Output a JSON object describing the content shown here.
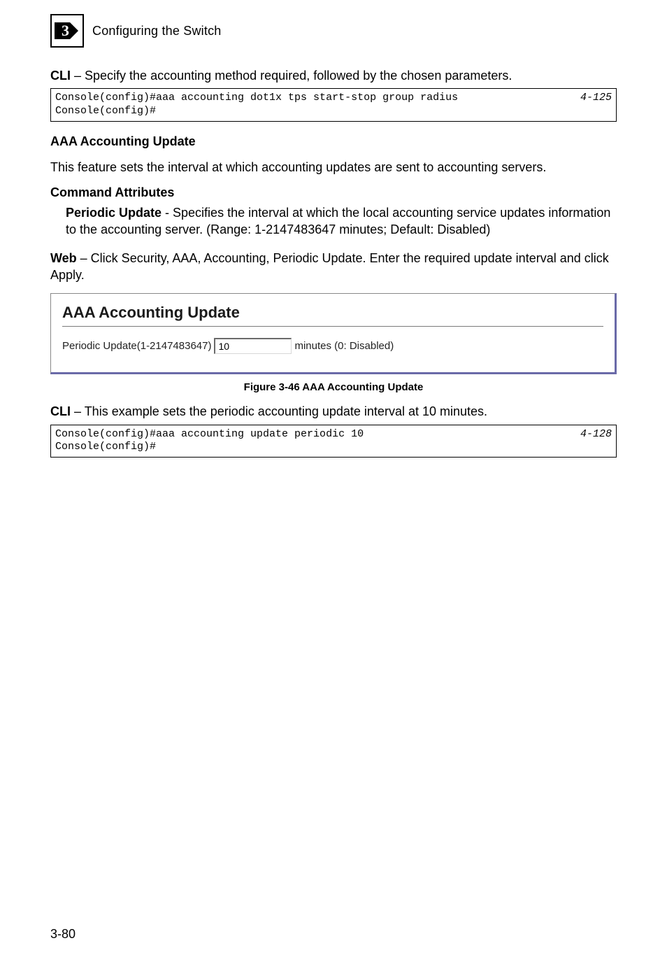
{
  "header": {
    "chapter_glyph": "3",
    "title": "Configuring the Switch"
  },
  "intro1": {
    "bold": "CLI",
    "rest": " – Specify the accounting method required, followed by the chosen parameters."
  },
  "code1": {
    "text": "Console(config)#aaa accounting dot1x tps start-stop group radius\nConsole(config)#",
    "ref": "4-125"
  },
  "section_heading": "AAA Accounting Update",
  "para1": "This feature sets the interval at which accounting updates are sent to accounting servers.",
  "cmd_attr_heading": "Command Attributes",
  "periodic": {
    "bold": "Periodic Update",
    "rest": " - Specifies the interval at which the local accounting service updates information to the accounting server. (Range: 1-2147483647 minutes; Default: Disabled)"
  },
  "web_para": {
    "bold": "Web",
    "rest": " – Click Security, AAA, Accounting, Periodic Update. Enter the required update interval and click Apply."
  },
  "panel": {
    "title": "AAA Accounting Update",
    "field_label_prefix": "Periodic Update(1-2147483647)",
    "field_value": "10",
    "field_label_suffix": "minutes (0: Disabled)"
  },
  "fig_caption": "Figure 3-46  AAA Accounting Update",
  "intro2": {
    "bold": "CLI",
    "rest": " – This example sets the periodic accounting update interval at 10 minutes."
  },
  "code2": {
    "text": "Console(config)#aaa accounting update periodic 10\nConsole(config)#",
    "ref": "4-128"
  },
  "footer_page": "3-80"
}
